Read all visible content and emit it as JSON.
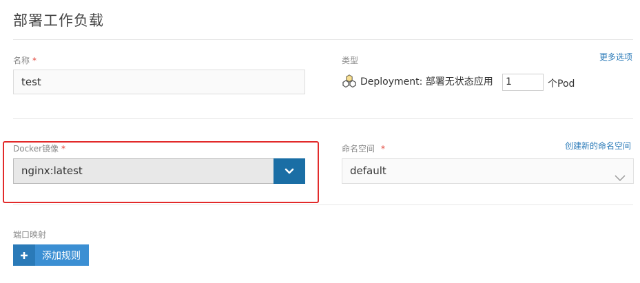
{
  "page": {
    "title": "部署工作负载"
  },
  "name_field": {
    "label": "名称",
    "required_mark": "*",
    "value": "test"
  },
  "type_field": {
    "label": "类型",
    "more_options": "更多选项",
    "deployment_text": "Deployment: 部署无状态应用",
    "pod_count": "1",
    "pod_suffix": "个Pod"
  },
  "image_field": {
    "label": "Docker镜像",
    "required_mark": "*",
    "value": "nginx:latest"
  },
  "namespace_field": {
    "label": "命名空间",
    "required_mark": "*",
    "create_link": "创建新的命名空间",
    "value": "default"
  },
  "port_mapping": {
    "label": "端口映射",
    "add_rule_label": "添加规则"
  },
  "colors": {
    "accent": "#1a6ea5",
    "button": "#3b8fd3",
    "highlight": "#e22a2a",
    "link": "#2a7ab8"
  },
  "icons": [
    "deployment-icon",
    "chevron-down-icon",
    "plus-icon"
  ]
}
